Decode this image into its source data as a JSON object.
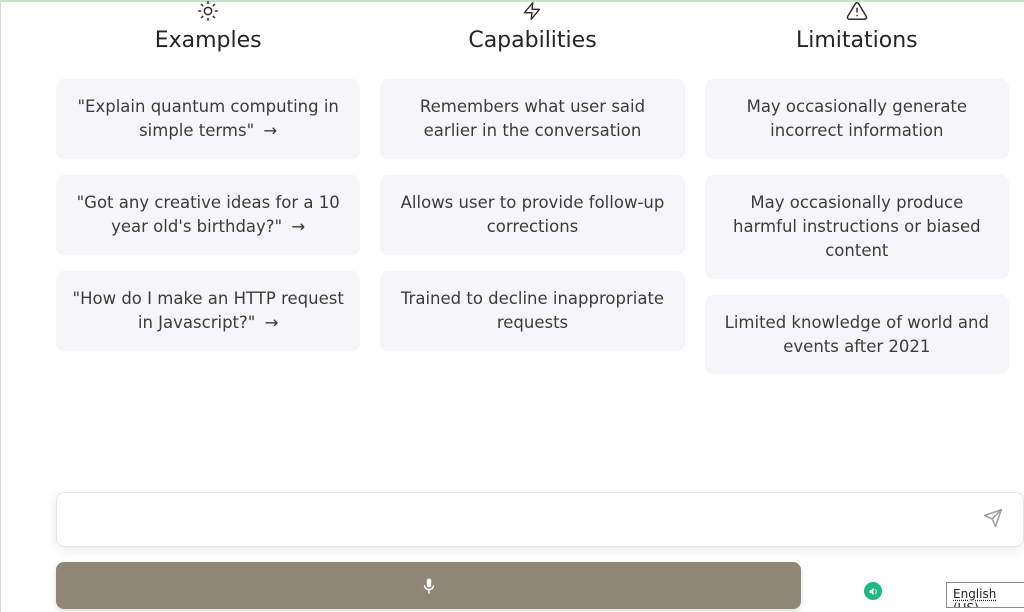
{
  "columns": {
    "examples": {
      "title": "Examples",
      "items": [
        "\"Explain quantum computing in simple terms\"",
        "\"Got any creative ideas for a 10 year old's birthday?\"",
        "\"How do I make an HTTP request in Javascript?\""
      ]
    },
    "capabilities": {
      "title": "Capabilities",
      "items": [
        "Remembers what user said earlier in the conversation",
        "Allows user to provide follow-up corrections",
        "Trained to decline inappropriate requests"
      ]
    },
    "limitations": {
      "title": "Limitations",
      "items": [
        "May occasionally generate incorrect information",
        "May occasionally produce harmful instructions or biased content",
        "Limited knowledge of world and events after 2021"
      ]
    }
  },
  "arrow_glyph": "→",
  "input": {
    "placeholder": ""
  },
  "language": "English (US)"
}
